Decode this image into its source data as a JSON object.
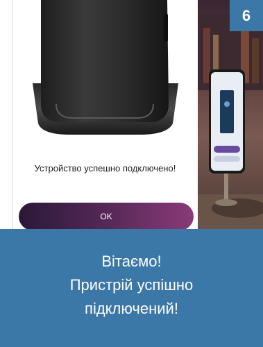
{
  "step": {
    "number": "6"
  },
  "phone_screen": {
    "success_message": "Устройство успешно подключено!",
    "ok_button_label": "OK"
  },
  "caption": {
    "line1": "Вітаємо!",
    "line2": "Пристрій успішно",
    "line3": "підключений!"
  },
  "colors": {
    "accent_blue": "#3b78a8",
    "button_gradient_start": "#2a1838",
    "button_gradient_end": "#8a3a78"
  }
}
